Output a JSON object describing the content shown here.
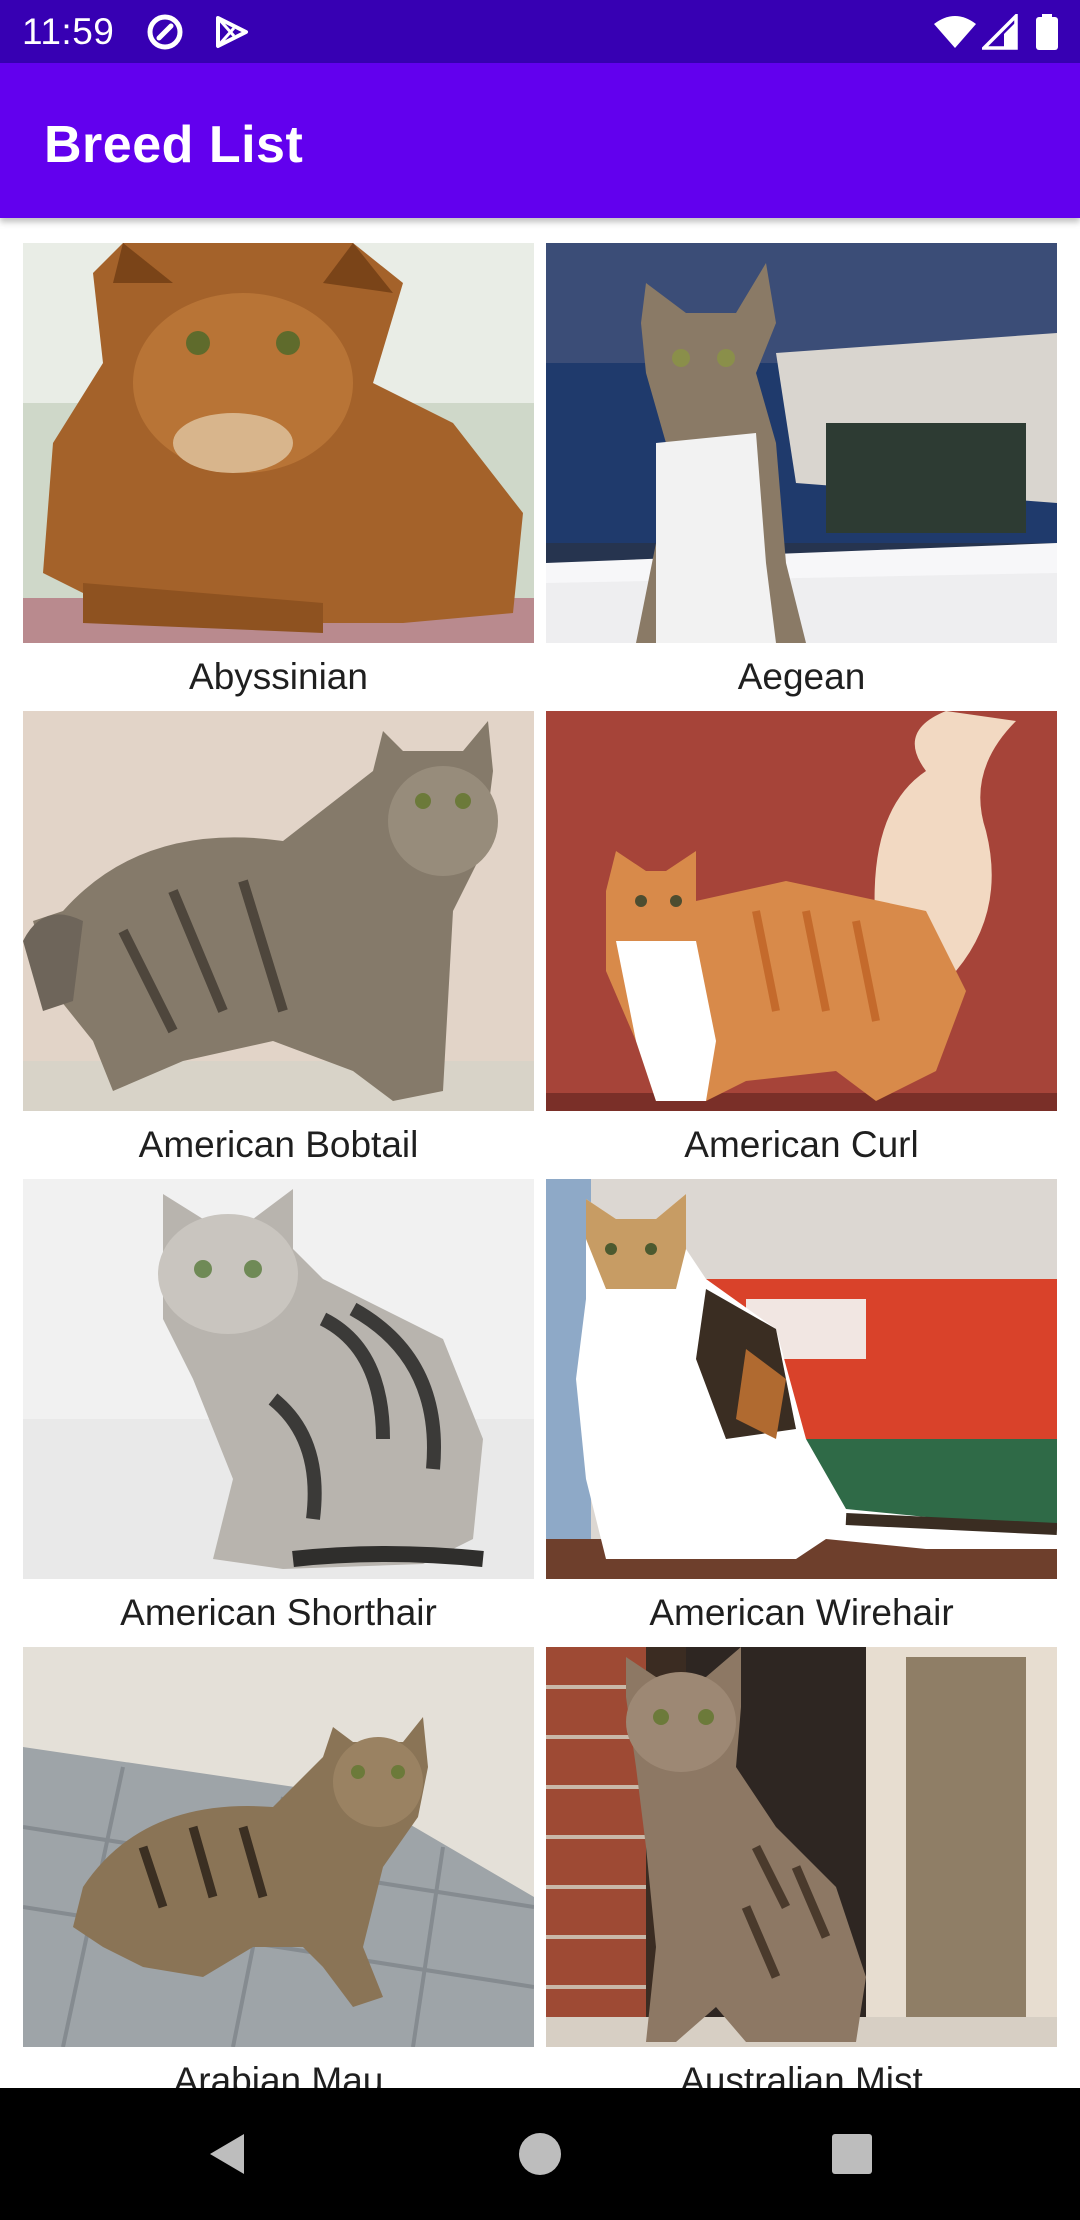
{
  "status_bar": {
    "time": "11:59",
    "icons": [
      "at-sign-icon",
      "play-store-icon",
      "wifi-icon",
      "signal-icon",
      "battery-icon"
    ],
    "background": "#3700b3"
  },
  "app_bar": {
    "title": "Breed List",
    "background": "#6200ee"
  },
  "breeds": [
    {
      "name": "Abyssinian"
    },
    {
      "name": "Aegean"
    },
    {
      "name": "American Bobtail"
    },
    {
      "name": "American Curl"
    },
    {
      "name": "American Shorthair"
    },
    {
      "name": "American Wirehair"
    },
    {
      "name": "Arabian Mau"
    },
    {
      "name": "Australian Mist"
    }
  ],
  "nav_bar": {
    "buttons": [
      "back-icon",
      "home-icon",
      "recents-icon"
    ]
  }
}
